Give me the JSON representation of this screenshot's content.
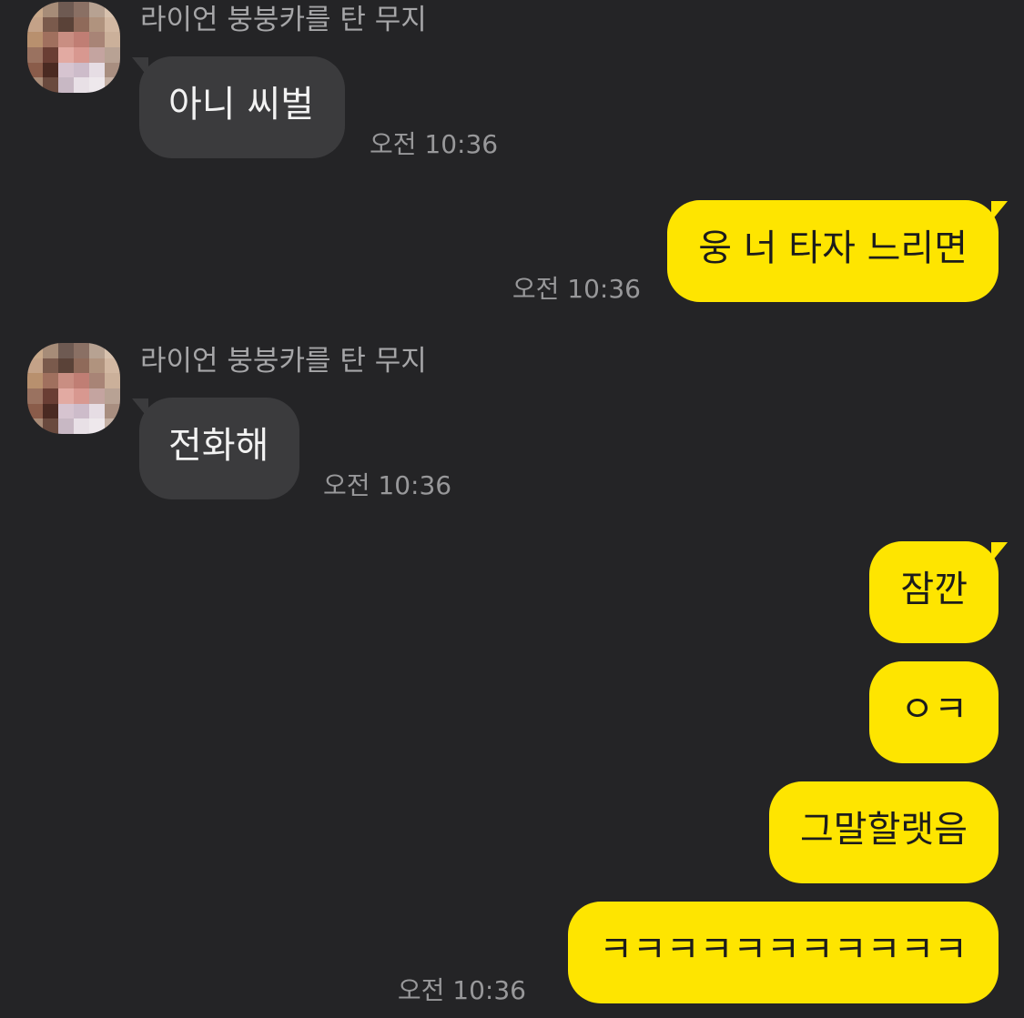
{
  "colors": {
    "background": "#242426",
    "incoming_bubble": "#3b3b3d",
    "outgoing_bubble": "#fee500",
    "sender_name": "#a6a6a8",
    "timestamp": "#98989a"
  },
  "messages": [
    {
      "direction": "incoming",
      "sender": "라이언 붕붕카를 탄 무지",
      "text": "아니 씨벌",
      "time": "오전 10:36"
    },
    {
      "direction": "outgoing",
      "text": "웅 너 타자 느리면",
      "time": "오전 10:36"
    },
    {
      "direction": "incoming",
      "sender": "라이언 붕붕카를 탄 무지",
      "text": "전화해",
      "time": "오전 10:36"
    },
    {
      "direction": "outgoing",
      "text": "잠깐"
    },
    {
      "direction": "outgoing",
      "text": "ㅇㅋ"
    },
    {
      "direction": "outgoing",
      "text": "그말할랫음"
    },
    {
      "direction": "outgoing",
      "text": "ㅋㅋㅋㅋㅋㅋㅋㅋㅋㅋㅋ",
      "time": "오전 10:36"
    }
  ]
}
